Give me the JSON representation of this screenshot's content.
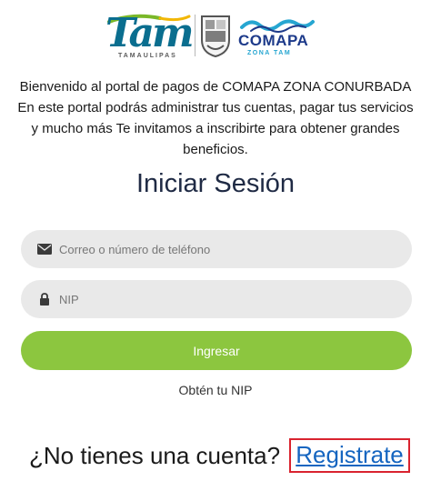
{
  "logos": {
    "tam_word": "Tam",
    "tam_sub": "TAMAULIPAS",
    "comapa_name": "COMAPA",
    "comapa_sub": "ZONA TAM"
  },
  "intro": {
    "text": "Bienvenido al portal de pagos de COMAPA ZONA CONURBADA En este portal podrás administrar tus cuentas, pagar tus servicios y mucho más Te invitamos a inscribirte para obtener grandes beneficios."
  },
  "login": {
    "title": "Iniciar Sesión",
    "email_placeholder": "Correo o número de teléfono",
    "nip_placeholder": "NIP",
    "submit_label": "Ingresar",
    "get_nip_label": "Obtén tu NIP"
  },
  "register": {
    "question": "¿No tienes una cuenta?",
    "link_label": "Registrate"
  },
  "icons": {
    "email": "envelope-icon",
    "nip": "lock-icon"
  },
  "colors": {
    "button": "#8cc63f",
    "title": "#1f2a44",
    "link": "#1565c0",
    "highlight_border": "#d9232f",
    "input_bg": "#e9e9e9"
  }
}
